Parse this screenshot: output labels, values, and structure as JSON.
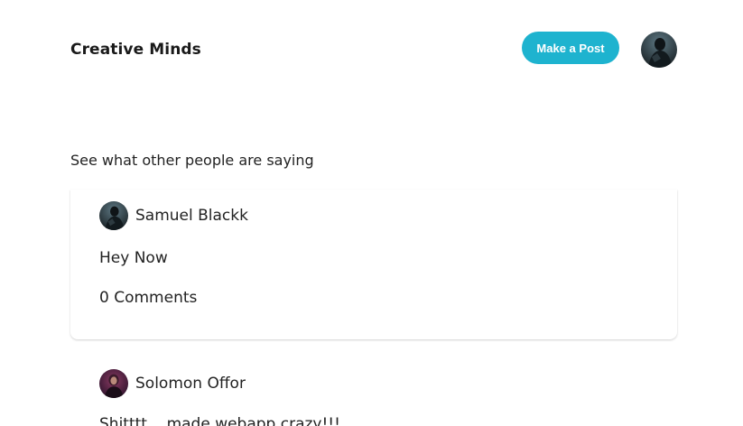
{
  "header": {
    "brand": "Creative Minds",
    "make_post_label": "Make a Post",
    "avatar_alt": "User avatar"
  },
  "feed": {
    "heading": "See what other people are saying",
    "posts": [
      {
        "author": "Samuel Blackk",
        "body": "Hey Now",
        "comments": "0 Comments",
        "avatar_color": "#2b3a40"
      },
      {
        "author": "Solomon Offor",
        "body": "Shitttt... made webapp crazy!!!",
        "avatar_color": "#5a1f3d"
      }
    ]
  },
  "colors": {
    "accent": "#1eb3cf"
  }
}
